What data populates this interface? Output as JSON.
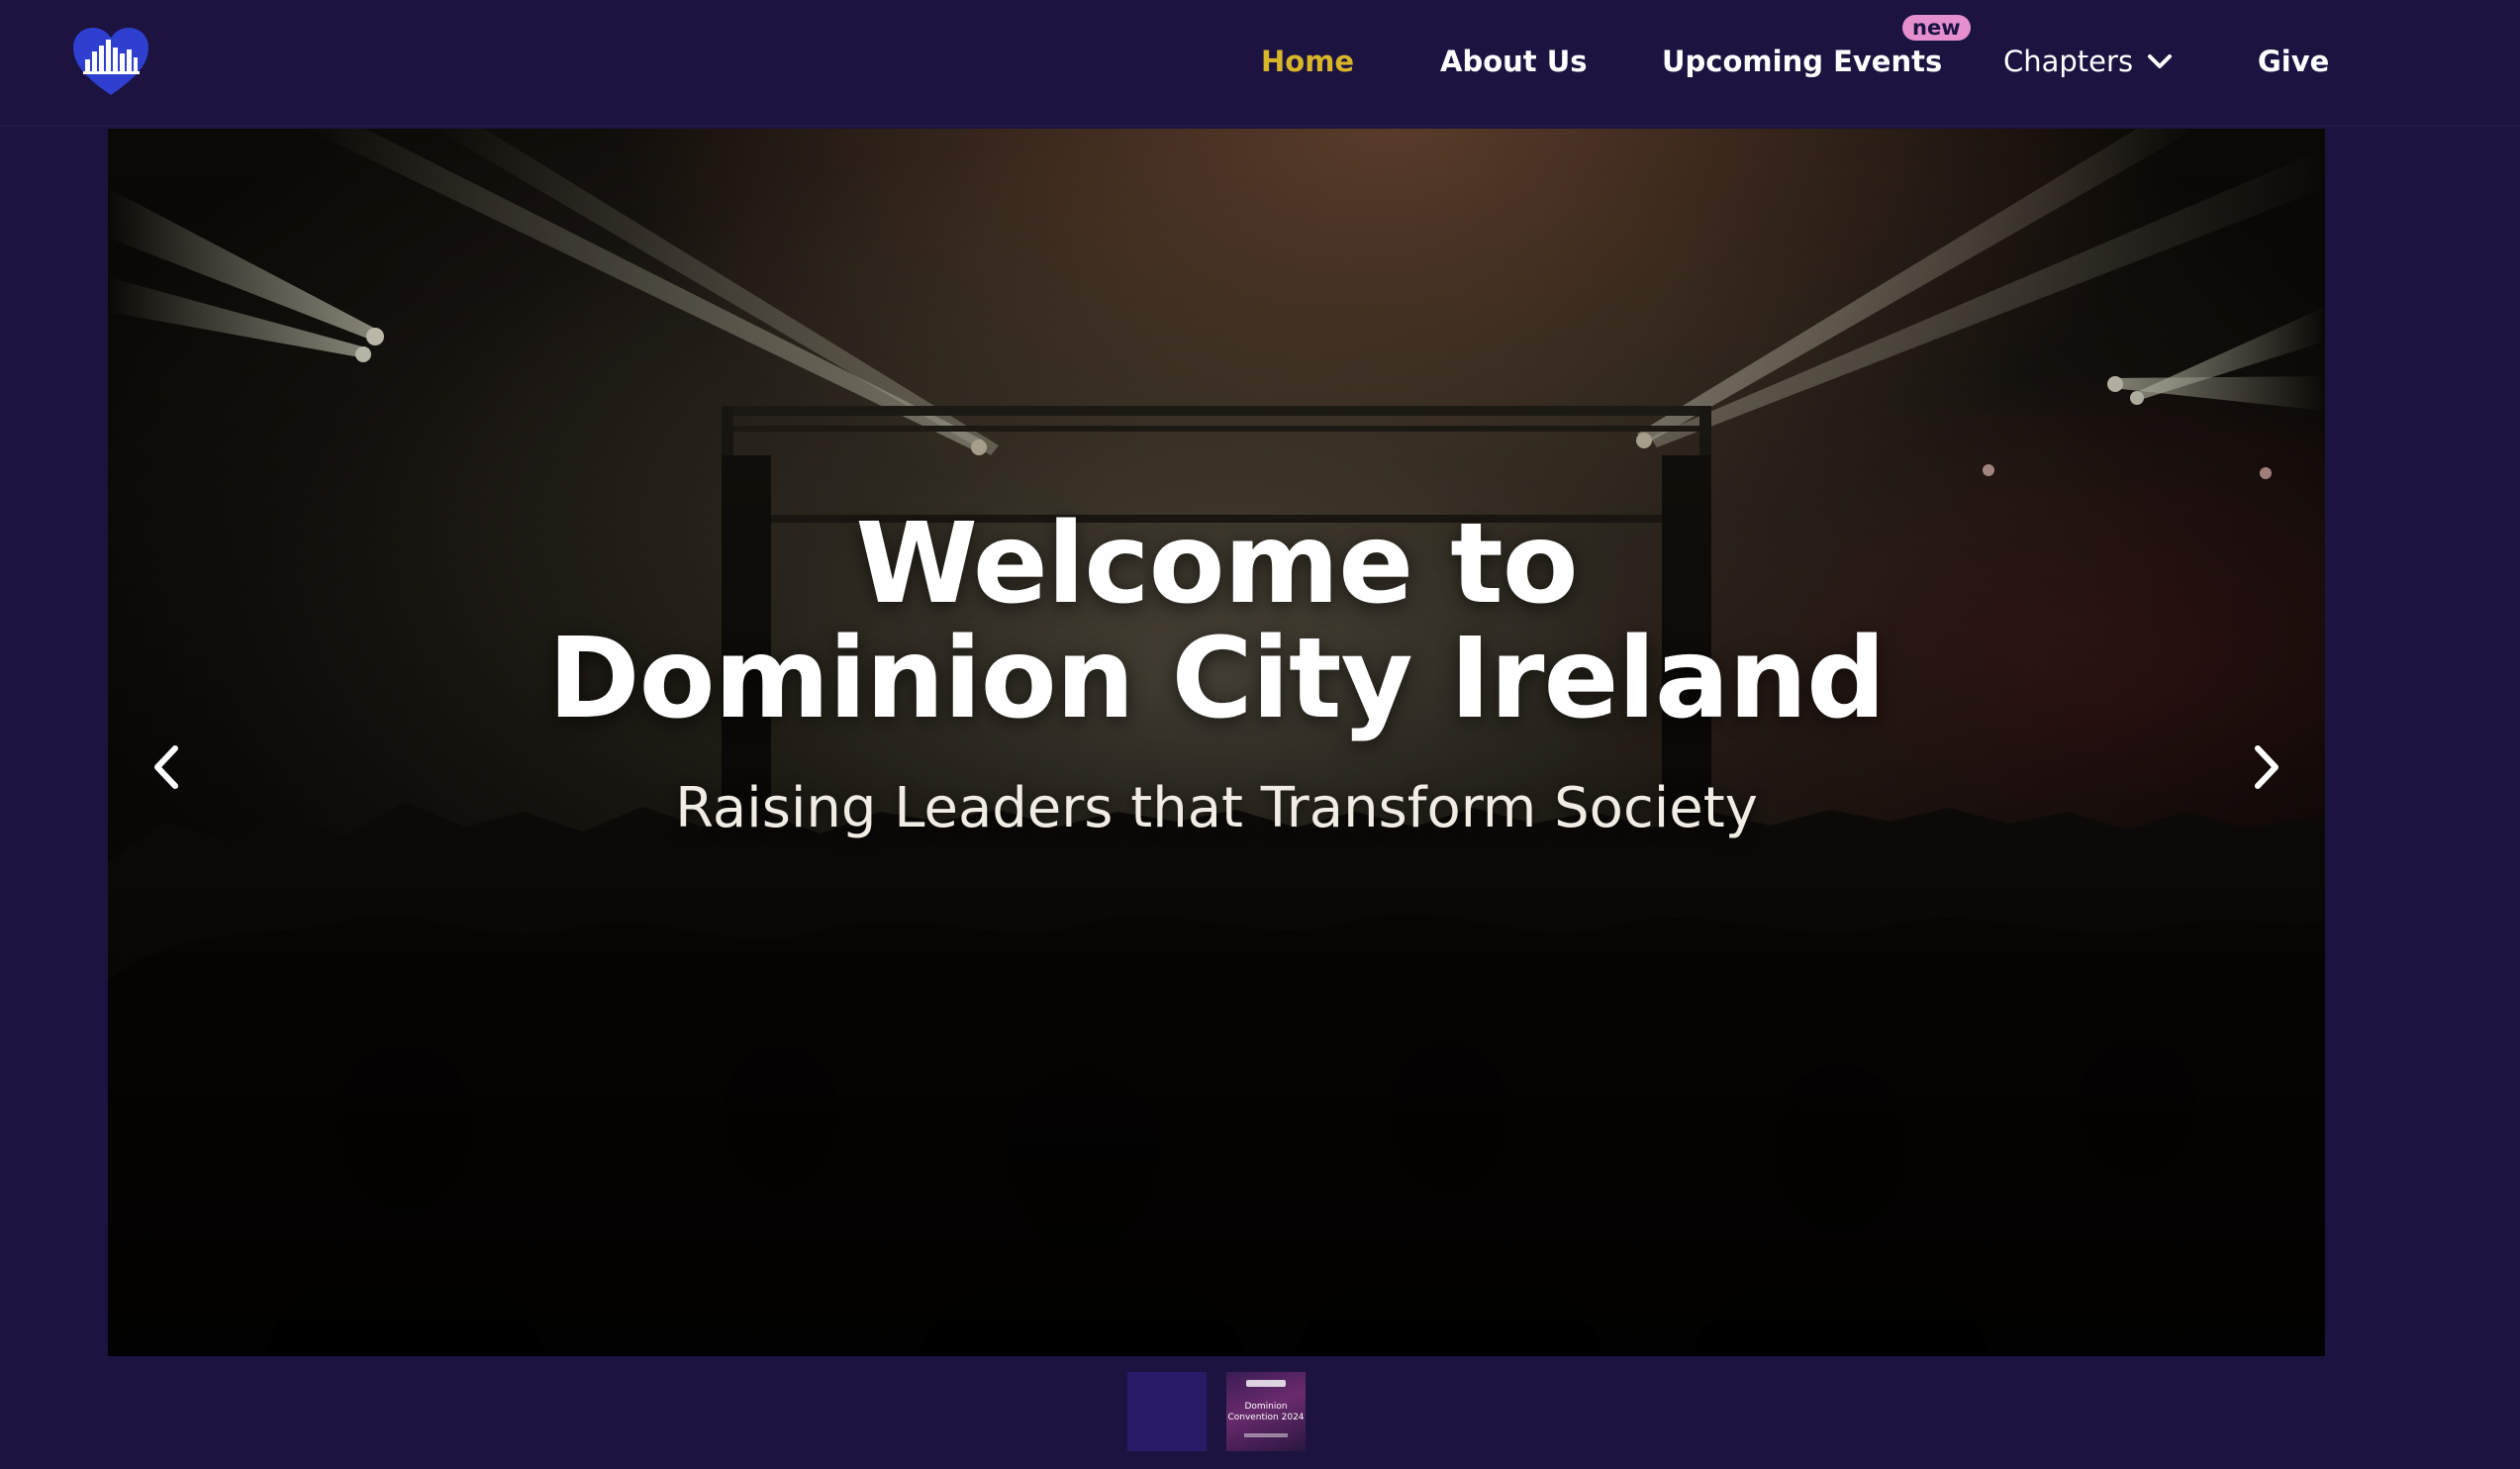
{
  "nav": {
    "logo_icon": "heart-skyline-logo-icon",
    "links": {
      "home": "Home",
      "about": "About Us",
      "events": "Upcoming Events",
      "chapters": "Chapters",
      "give": "Give"
    },
    "events_badge": "new",
    "chapters_icon": "chevron-down-icon",
    "active_link": "home"
  },
  "hero": {
    "title_line1": "Welcome to",
    "title_line2": "Dominion City Ireland",
    "subtitle": "Raising Leaders that Transform Society",
    "prev_icon": "chevron-left-icon",
    "next_icon": "chevron-right-icon"
  },
  "thumbnails": {
    "slide2_title_line1": "Dominion",
    "slide2_title_line2": "Convention 2024"
  },
  "colors": {
    "background": "#1c1340",
    "active_link": "#d9b52a",
    "badge": "#e58fcf",
    "logo": "#2f3fcf"
  }
}
